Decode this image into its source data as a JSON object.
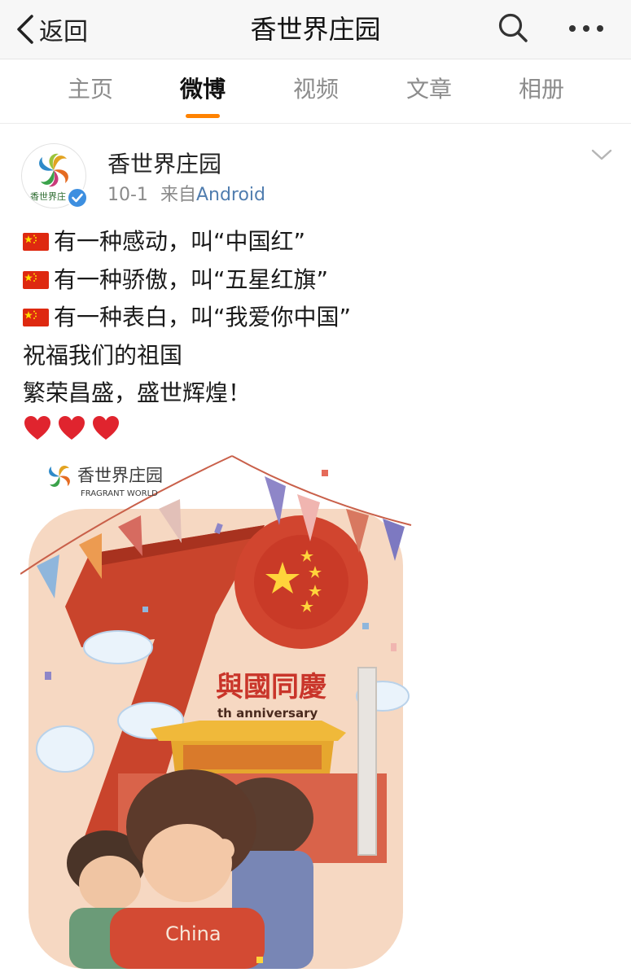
{
  "topbar": {
    "back_label": "返回",
    "title": "香世界庄园",
    "icons": [
      "chevron-left-icon",
      "search-icon",
      "more-icon"
    ]
  },
  "tabs": [
    {
      "label": "主页",
      "active": false
    },
    {
      "label": "微博",
      "active": true
    },
    {
      "label": "视频",
      "active": false
    },
    {
      "label": "文章",
      "active": false
    },
    {
      "label": "相册",
      "active": false
    }
  ],
  "post": {
    "author": "香世界庄园",
    "avatar_text": "香世界庄",
    "date": "10-1",
    "source_prefix": "来自",
    "source": "Android",
    "lines": [
      "有一种感动，叫“中国红”",
      "有一种骄傲，叫“五星红旗”",
      "有一种表白，叫“我爱你中国”",
      "祝福我们的祖国",
      "繁荣昌盛，盛世辉煌！"
    ],
    "flag_icon": "china-flag-icon",
    "heart_icon": "red-heart-icon"
  },
  "poster": {
    "logo_cn": "香世界庄园",
    "logo_en": "FRAGRANT WORLD",
    "headline": "與國同慶",
    "anniversary": "th anniversary",
    "shirt_text": "China"
  },
  "colors": {
    "accent_tab": "#ff8200",
    "link": "#507daf",
    "poster_red": "#c9442c",
    "poster_bg": "#f6d8c2"
  }
}
